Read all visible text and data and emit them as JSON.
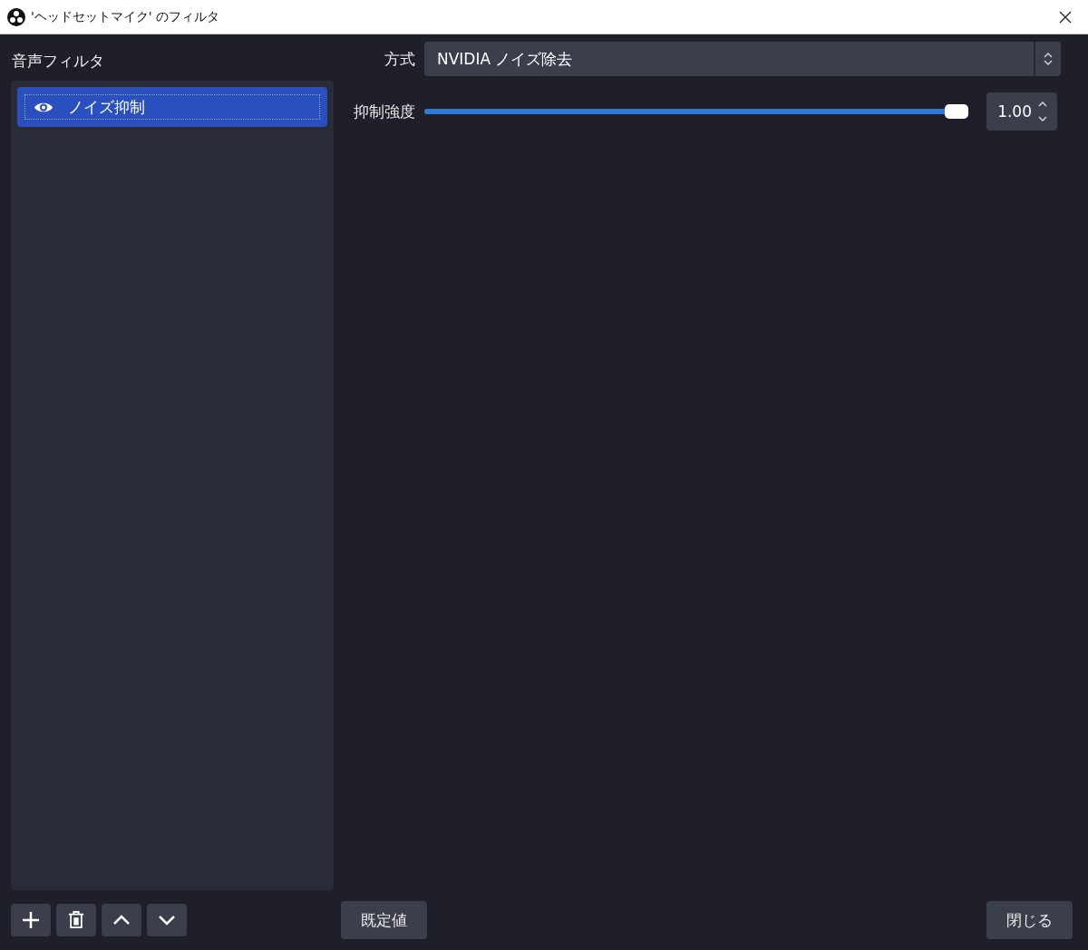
{
  "window": {
    "title": "'ヘッドセットマイク' のフィルタ"
  },
  "filters_section": {
    "label": "音声フィルタ",
    "items": [
      {
        "name": "ノイズ抑制",
        "visible": true,
        "selected": true
      }
    ]
  },
  "properties": [
    {
      "kind": "select",
      "label": "方式",
      "value": "NVIDIA ノイズ除去"
    },
    {
      "kind": "slider",
      "label": "抑制強度",
      "level": 1.0,
      "reading": "1.00"
    }
  ],
  "buttons": {
    "defaults": "既定値",
    "close": "閉じる"
  }
}
